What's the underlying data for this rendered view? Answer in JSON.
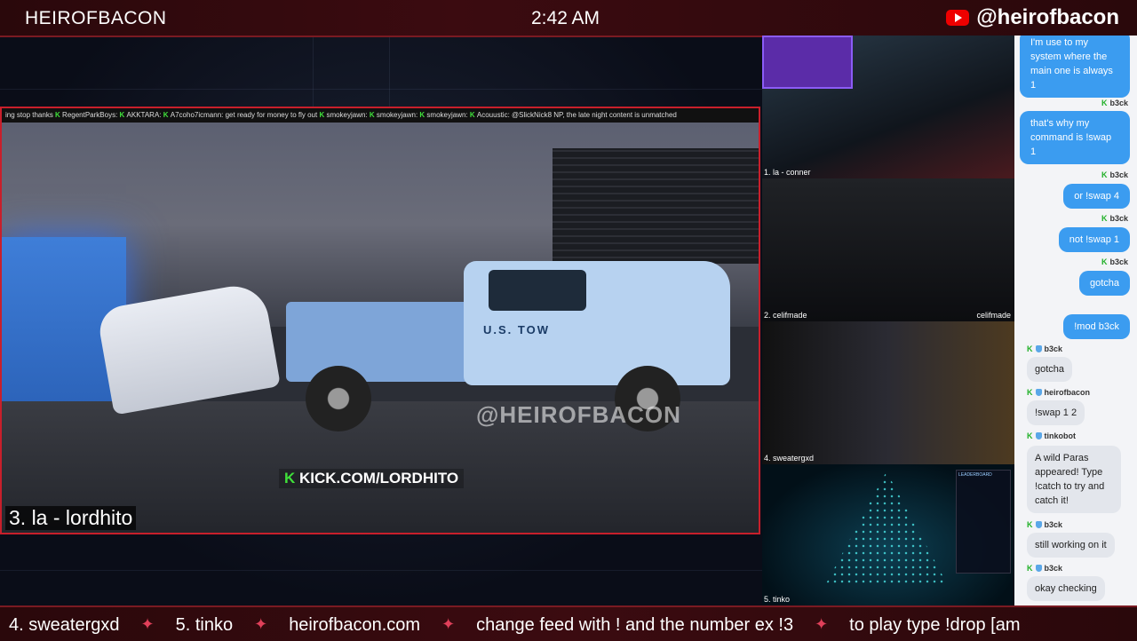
{
  "header": {
    "brand": "HEIROFBACON",
    "clock": "2:42 AM",
    "handle": "@heirofbacon"
  },
  "main_feed": {
    "ticker": [
      {
        "text": "ing stop thanks"
      },
      {
        "user": "RegentParkBoys:"
      },
      {
        "user": "AKKTARA:"
      },
      {
        "user": "A7coho7icmann:",
        "text": "get ready for money to fly out"
      },
      {
        "user": "smokeyjawn:"
      },
      {
        "user": "smokeyjawn:"
      },
      {
        "user": "smokeyjawn:"
      },
      {
        "user": "Acouustic:",
        "text": "@SlickNick8 NP, the late night content is unmatched"
      }
    ],
    "truck_text": "U.S. TOW",
    "watermark": "@HEIROFBACON",
    "kick_tag": "KICK.COM/LORDHITO",
    "label": "3. la - lordhito"
  },
  "side_feeds": [
    {
      "label": "1. la - conner"
    },
    {
      "label": "2. celifmade",
      "tag": "celifmade"
    },
    {
      "label": "4. sweatergxd"
    },
    {
      "label": "5. tinko",
      "leaderboard_title": "LEADERBOARD"
    }
  ],
  "chat": {
    "messages": [
      {
        "side": "right",
        "text": "I'm use to my system where the main one is always 1",
        "meta": "b3ck"
      },
      {
        "side": "right",
        "text": "that's why my command is !swap 1",
        "meta": "b3ck"
      },
      {
        "side": "right",
        "text": "or !swap 4",
        "meta": "b3ck"
      },
      {
        "side": "right",
        "text": "not !swap 1",
        "meta": "b3ck"
      },
      {
        "side": "right",
        "text": "gotcha"
      },
      {
        "side": "right",
        "text": "!mod b3ck"
      },
      {
        "side": "left",
        "user": "b3ck",
        "text": "gotcha"
      },
      {
        "side": "left",
        "user": "heirofbacon",
        "text": "!swap 1 2"
      },
      {
        "side": "left",
        "user": "tinkobot",
        "text": "A wild Paras appeared! Type !catch to try and catch it!"
      },
      {
        "side": "left",
        "user": "b3ck",
        "text": "still working on it"
      },
      {
        "side": "left",
        "user": "b3ck",
        "text": "okay checking"
      }
    ]
  },
  "footer": {
    "items": [
      "4. sweatergxd",
      "5. tinko",
      "heirofbacon.com",
      "change feed with ! and the number ex !3",
      "to play type !drop [am"
    ]
  },
  "colors": {
    "accent": "#c81f2b",
    "chat_bubble": "#3b9cf0",
    "kick_green": "#3fe03a"
  }
}
